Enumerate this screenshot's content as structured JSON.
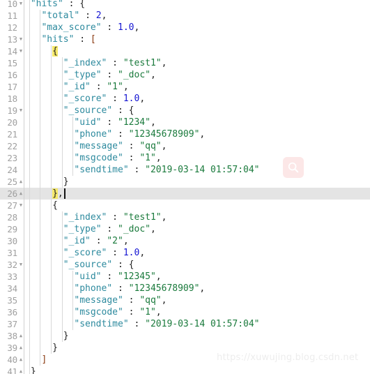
{
  "editor": {
    "language": "json",
    "first_visible_line": 10,
    "last_visible_line": 41,
    "active_line": 26,
    "line_height_px": 17,
    "colors": {
      "background": "#ffffff",
      "active_line": "#e4e4e4",
      "gutter_text": "#a0a0a0",
      "key": "#2d8a9e",
      "string": "#1a7a3c",
      "number": "#1414d2",
      "punctuation": "#222222",
      "bracket": "#8a3a10",
      "brace_match_highlight": "#f5e96a",
      "indent_guide": "#d8d8d8",
      "caret": "#111111",
      "watermark": "#ededed",
      "search_overlay_bg": "#fce7e7"
    },
    "lines": [
      {
        "num": "10",
        "fold": "down",
        "indent": 1,
        "text": "\"hits\" : {",
        "tokens": [
          {
            "t": "key",
            "v": "\"hits\""
          },
          {
            "t": "punct",
            "v": " : "
          },
          {
            "t": "brace",
            "v": "{"
          }
        ]
      },
      {
        "num": "11",
        "fold": "",
        "indent": 2,
        "text": "\"total\" : 2,",
        "tokens": [
          {
            "t": "key",
            "v": "\"total\""
          },
          {
            "t": "punct",
            "v": " : "
          },
          {
            "t": "num",
            "v": "2"
          },
          {
            "t": "punct",
            "v": ","
          }
        ]
      },
      {
        "num": "12",
        "fold": "",
        "indent": 2,
        "text": "\"max_score\" : 1.0,",
        "tokens": [
          {
            "t": "key",
            "v": "\"max_score\""
          },
          {
            "t": "punct",
            "v": " : "
          },
          {
            "t": "num",
            "v": "1.0"
          },
          {
            "t": "punct",
            "v": ","
          }
        ]
      },
      {
        "num": "13",
        "fold": "down",
        "indent": 2,
        "text": "\"hits\" : [",
        "tokens": [
          {
            "t": "key",
            "v": "\"hits\""
          },
          {
            "t": "punct",
            "v": " : "
          },
          {
            "t": "bracket",
            "v": "["
          }
        ]
      },
      {
        "num": "14",
        "fold": "down",
        "indent": 3,
        "text": "{",
        "tokens": [
          {
            "t": "brace-hl",
            "v": "{"
          }
        ]
      },
      {
        "num": "15",
        "fold": "",
        "indent": 4,
        "text": "\"_index\" : \"test1\",",
        "tokens": [
          {
            "t": "key",
            "v": "\"_index\""
          },
          {
            "t": "punct",
            "v": " : "
          },
          {
            "t": "str",
            "v": "\"test1\""
          },
          {
            "t": "punct",
            "v": ","
          }
        ]
      },
      {
        "num": "16",
        "fold": "",
        "indent": 4,
        "text": "\"_type\" : \"_doc\",",
        "tokens": [
          {
            "t": "key",
            "v": "\"_type\""
          },
          {
            "t": "punct",
            "v": " : "
          },
          {
            "t": "str",
            "v": "\"_doc\""
          },
          {
            "t": "punct",
            "v": ","
          }
        ]
      },
      {
        "num": "17",
        "fold": "",
        "indent": 4,
        "text": "\"_id\" : \"1\",",
        "tokens": [
          {
            "t": "key",
            "v": "\"_id\""
          },
          {
            "t": "punct",
            "v": " : "
          },
          {
            "t": "str",
            "v": "\"1\""
          },
          {
            "t": "punct",
            "v": ","
          }
        ]
      },
      {
        "num": "18",
        "fold": "",
        "indent": 4,
        "text": "\"_score\" : 1.0,",
        "tokens": [
          {
            "t": "key",
            "v": "\"_score\""
          },
          {
            "t": "punct",
            "v": " : "
          },
          {
            "t": "num",
            "v": "1.0"
          },
          {
            "t": "punct",
            "v": ","
          }
        ]
      },
      {
        "num": "19",
        "fold": "down",
        "indent": 4,
        "text": "\"_source\" : {",
        "tokens": [
          {
            "t": "key",
            "v": "\"_source\""
          },
          {
            "t": "punct",
            "v": " : "
          },
          {
            "t": "brace",
            "v": "{"
          }
        ]
      },
      {
        "num": "20",
        "fold": "",
        "indent": 5,
        "text": "\"uid\" : \"1234\",",
        "tokens": [
          {
            "t": "key",
            "v": "\"uid\""
          },
          {
            "t": "punct",
            "v": " : "
          },
          {
            "t": "str",
            "v": "\"1234\""
          },
          {
            "t": "punct",
            "v": ","
          }
        ]
      },
      {
        "num": "21",
        "fold": "",
        "indent": 5,
        "text": "\"phone\" : \"12345678909\",",
        "tokens": [
          {
            "t": "key",
            "v": "\"phone\""
          },
          {
            "t": "punct",
            "v": " : "
          },
          {
            "t": "str",
            "v": "\"12345678909\""
          },
          {
            "t": "punct",
            "v": ","
          }
        ]
      },
      {
        "num": "22",
        "fold": "",
        "indent": 5,
        "text": "\"message\" : \"qq\",",
        "tokens": [
          {
            "t": "key",
            "v": "\"message\""
          },
          {
            "t": "punct",
            "v": " : "
          },
          {
            "t": "str",
            "v": "\"qq\""
          },
          {
            "t": "punct",
            "v": ","
          }
        ]
      },
      {
        "num": "23",
        "fold": "",
        "indent": 5,
        "text": "\"msgcode\" : \"1\",",
        "tokens": [
          {
            "t": "key",
            "v": "\"msgcode\""
          },
          {
            "t": "punct",
            "v": " : "
          },
          {
            "t": "str",
            "v": "\"1\""
          },
          {
            "t": "punct",
            "v": ","
          }
        ]
      },
      {
        "num": "24",
        "fold": "",
        "indent": 5,
        "text": "\"sendtime\" : \"2019-03-14 01:57:04\"",
        "tokens": [
          {
            "t": "key",
            "v": "\"sendtime\""
          },
          {
            "t": "punct",
            "v": " : "
          },
          {
            "t": "str",
            "v": "\"2019-03-14 01:57:04\""
          }
        ]
      },
      {
        "num": "25",
        "fold": "up",
        "indent": 4,
        "text": "}",
        "tokens": [
          {
            "t": "brace",
            "v": "}"
          }
        ]
      },
      {
        "num": "26",
        "fold": "up",
        "indent": 3,
        "text": "},",
        "tokens": [
          {
            "t": "brace-hl",
            "v": "}"
          },
          {
            "t": "punct",
            "v": ","
          }
        ]
      },
      {
        "num": "27",
        "fold": "down",
        "indent": 3,
        "text": "{",
        "tokens": [
          {
            "t": "brace",
            "v": "{"
          }
        ]
      },
      {
        "num": "28",
        "fold": "",
        "indent": 4,
        "text": "\"_index\" : \"test1\",",
        "tokens": [
          {
            "t": "key",
            "v": "\"_index\""
          },
          {
            "t": "punct",
            "v": " : "
          },
          {
            "t": "str",
            "v": "\"test1\""
          },
          {
            "t": "punct",
            "v": ","
          }
        ]
      },
      {
        "num": "29",
        "fold": "",
        "indent": 4,
        "text": "\"_type\" : \"_doc\",",
        "tokens": [
          {
            "t": "key",
            "v": "\"_type\""
          },
          {
            "t": "punct",
            "v": " : "
          },
          {
            "t": "str",
            "v": "\"_doc\""
          },
          {
            "t": "punct",
            "v": ","
          }
        ]
      },
      {
        "num": "30",
        "fold": "",
        "indent": 4,
        "text": "\"_id\" : \"2\",",
        "tokens": [
          {
            "t": "key",
            "v": "\"_id\""
          },
          {
            "t": "punct",
            "v": " : "
          },
          {
            "t": "str",
            "v": "\"2\""
          },
          {
            "t": "punct",
            "v": ","
          }
        ]
      },
      {
        "num": "31",
        "fold": "",
        "indent": 4,
        "text": "\"_score\" : 1.0,",
        "tokens": [
          {
            "t": "key",
            "v": "\"_score\""
          },
          {
            "t": "punct",
            "v": " : "
          },
          {
            "t": "num",
            "v": "1.0"
          },
          {
            "t": "punct",
            "v": ","
          }
        ]
      },
      {
        "num": "32",
        "fold": "down",
        "indent": 4,
        "text": "\"_source\" : {",
        "tokens": [
          {
            "t": "key",
            "v": "\"_source\""
          },
          {
            "t": "punct",
            "v": " : "
          },
          {
            "t": "brace",
            "v": "{"
          }
        ]
      },
      {
        "num": "33",
        "fold": "",
        "indent": 5,
        "text": "\"uid\" : \"12345\",",
        "tokens": [
          {
            "t": "key",
            "v": "\"uid\""
          },
          {
            "t": "punct",
            "v": " : "
          },
          {
            "t": "str",
            "v": "\"12345\""
          },
          {
            "t": "punct",
            "v": ","
          }
        ]
      },
      {
        "num": "34",
        "fold": "",
        "indent": 5,
        "text": "\"phone\" : \"12345678909\",",
        "tokens": [
          {
            "t": "key",
            "v": "\"phone\""
          },
          {
            "t": "punct",
            "v": " : "
          },
          {
            "t": "str",
            "v": "\"12345678909\""
          },
          {
            "t": "punct",
            "v": ","
          }
        ]
      },
      {
        "num": "35",
        "fold": "",
        "indent": 5,
        "text": "\"message\" : \"qq\",",
        "tokens": [
          {
            "t": "key",
            "v": "\"message\""
          },
          {
            "t": "punct",
            "v": " : "
          },
          {
            "t": "str",
            "v": "\"qq\""
          },
          {
            "t": "punct",
            "v": ","
          }
        ]
      },
      {
        "num": "36",
        "fold": "",
        "indent": 5,
        "text": "\"msgcode\" : \"1\",",
        "tokens": [
          {
            "t": "key",
            "v": "\"msgcode\""
          },
          {
            "t": "punct",
            "v": " : "
          },
          {
            "t": "str",
            "v": "\"1\""
          },
          {
            "t": "punct",
            "v": ","
          }
        ]
      },
      {
        "num": "37",
        "fold": "",
        "indent": 5,
        "text": "\"sendtime\" : \"2019-03-14 01:57:04\"",
        "tokens": [
          {
            "t": "key",
            "v": "\"sendtime\""
          },
          {
            "t": "punct",
            "v": " : "
          },
          {
            "t": "str",
            "v": "\"2019-03-14 01:57:04\""
          }
        ]
      },
      {
        "num": "38",
        "fold": "up",
        "indent": 4,
        "text": "}",
        "tokens": [
          {
            "t": "brace",
            "v": "}"
          }
        ]
      },
      {
        "num": "39",
        "fold": "up",
        "indent": 3,
        "text": "}",
        "tokens": [
          {
            "t": "brace",
            "v": "}"
          }
        ]
      },
      {
        "num": "40",
        "fold": "up",
        "indent": 2,
        "text": "]",
        "tokens": [
          {
            "t": "bracket",
            "v": "]"
          }
        ]
      },
      {
        "num": "41",
        "fold": "up",
        "indent": 1,
        "text": "}",
        "tokens": [
          {
            "t": "brace",
            "v": "}"
          }
        ]
      }
    ]
  },
  "overlay": {
    "search_icon_name": "search-icon"
  },
  "watermark": {
    "text": "https://xuwujing.blog.csdn.net"
  }
}
